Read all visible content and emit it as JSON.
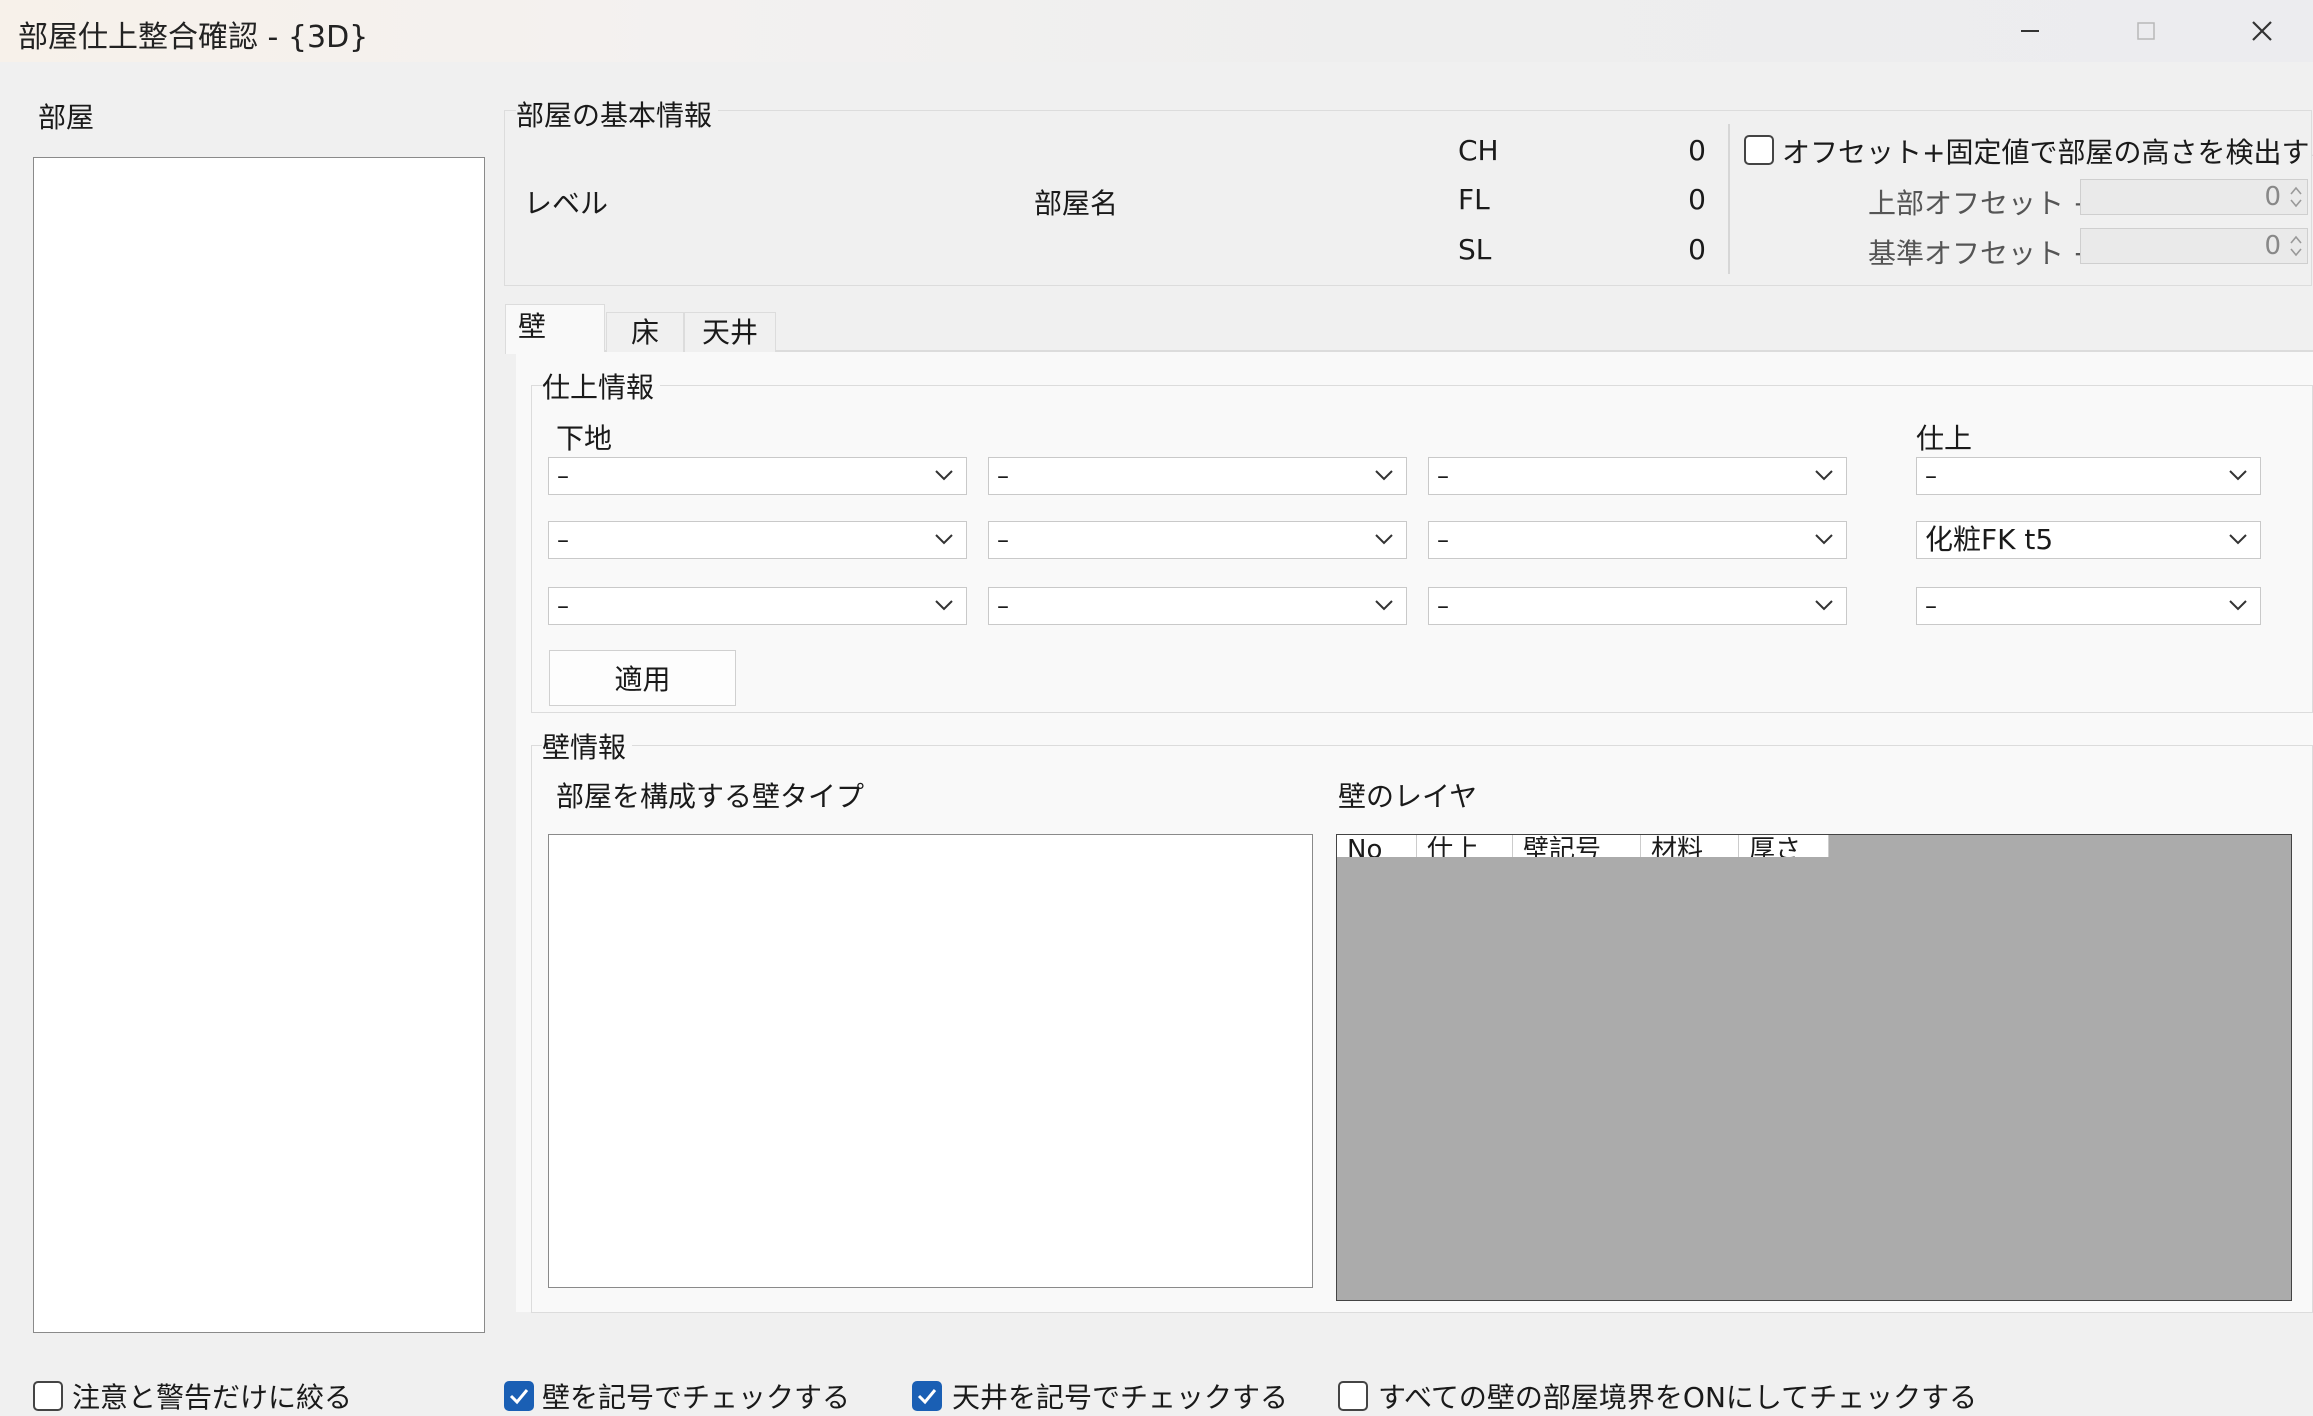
{
  "window": {
    "title": "部屋仕上整合確認 - {3D}",
    "controls": [
      "minimize-icon",
      "maximize-icon",
      "close-icon"
    ]
  },
  "rooms_panel": {
    "label": "部屋"
  },
  "basic_info": {
    "group_label": "部屋の基本情報",
    "level_label": "レベル",
    "room_name_label": "部屋名",
    "ch_label": "CH",
    "ch_value": "0",
    "fl_label": "FL",
    "fl_value": "0",
    "sl_label": "SL",
    "sl_value": "0",
    "offset_checkbox_label": "オフセット+固定値で部屋の高さを検出する",
    "offset_checked": false,
    "top_offset_label": "上部オフセット +",
    "top_offset_value": "0",
    "base_offset_label": "基準オフセット −",
    "base_offset_value": "0"
  },
  "tabs": [
    {
      "label": "壁",
      "active": true
    },
    {
      "label": "床",
      "active": false
    },
    {
      "label": "天井",
      "active": false
    }
  ],
  "finish_info": {
    "group_label": "仕上情報",
    "base_label": "下地",
    "finish_label": "仕上",
    "base_rows": [
      [
        "–",
        "–",
        "–"
      ],
      [
        "–",
        "–",
        "–"
      ],
      [
        "–",
        "–",
        "–"
      ]
    ],
    "finish_rows": [
      "–",
      "化粧FK t5",
      "–"
    ],
    "apply_button": "適用"
  },
  "wall_info": {
    "group_label": "壁情報",
    "wall_types_label": "部屋を構成する壁タイプ",
    "layers_label": "壁のレイヤ",
    "layer_columns": [
      "No",
      "仕上",
      "壁記号",
      "材料",
      "厚さ"
    ]
  },
  "bottom_options": [
    {
      "label": "注意と警告だけに絞る",
      "checked": false
    },
    {
      "label": "壁を記号でチェックする",
      "checked": true
    },
    {
      "label": "天井を記号でチェックする",
      "checked": true
    },
    {
      "label": "すべての壁の部屋境界をONにしてチェックする",
      "checked": false
    }
  ],
  "colors": {
    "accent": "#1a5fb4",
    "grid_background": "#ababab",
    "window_background": "#f0f0f0"
  }
}
